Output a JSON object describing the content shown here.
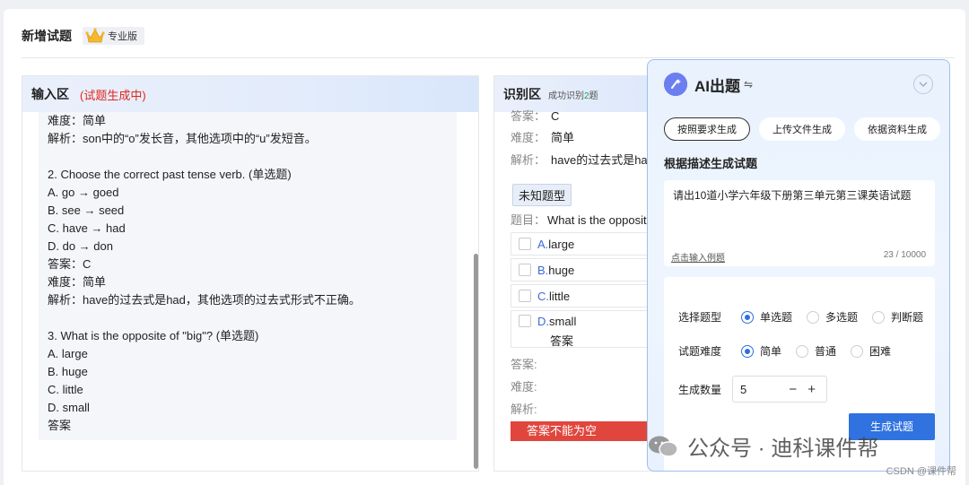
{
  "page": {
    "title": "新增试题",
    "badge": "专业版"
  },
  "input_panel": {
    "title": "输入区",
    "status": "(试题生成中)",
    "lines": [
      "难度：简单",
      "解析：son中的“o”发长音，其他选项中的“u”发短音。",
      "",
      "2. Choose the correct past tense verb. (单选题)",
      "A. go → goed",
      "B. see → seed",
      "C. have → had",
      "D. do → don",
      "答案：C",
      "难度：简单",
      "解析：have的过去式是had，其他选项的过去式形式不正确。",
      "",
      "3. What is the opposite of \"big\"? (单选题)",
      "A. large",
      "B. huge",
      "C. little",
      "D. small",
      "答案"
    ]
  },
  "recognition_panel": {
    "title": "识别区",
    "success_prefix": "成功识别",
    "success_count": "2",
    "success_suffix": "题",
    "answer_label_top": "答案：",
    "answer_value_top": "C",
    "difficulty_label": "难度：",
    "difficulty_value": "简单",
    "analysis_label": "解析：",
    "analysis_value": "have的过去式是had,",
    "type_tag": "未知题型",
    "question_label": "题目：",
    "question_value": "What is the opposit",
    "options": [
      {
        "letter": "A.",
        "text": "large"
      },
      {
        "letter": "B.",
        "text": "huge"
      },
      {
        "letter": "C.",
        "text": "little"
      },
      {
        "letter": "D.",
        "text": "small"
      }
    ],
    "option_extra": "答案",
    "answer_label": "答案:",
    "difficulty_label2": "难度:",
    "analysis_label2": "解析:",
    "error": "答案不能为空"
  },
  "ai_panel": {
    "title": "AI出题",
    "swap_icon": "⇋",
    "tabs": [
      "按照要求生成",
      "上传文件生成",
      "依据资料生成"
    ],
    "section_title": "根据描述生成试题",
    "prompt": "请出10道小学六年级下册第三单元第三课英语试题",
    "example_link": "点击输入例题",
    "char_count": "23 / 10000",
    "type_label": "选择题型",
    "type_options": [
      "单选题",
      "多选题",
      "判断题"
    ],
    "difficulty_label": "试题难度",
    "difficulty_options": [
      "简单",
      "普通",
      "困难"
    ],
    "count_label": "生成数量",
    "count_value": "5",
    "stepper_controls": "− +",
    "generate_button": "生成试题"
  },
  "watermark": {
    "text": "公众号 · 迪科课件帮",
    "csdn": "CSDN @课件帮"
  },
  "colors": {
    "accent": "#2f72e0",
    "error": "#e0463d",
    "status_red": "#e0261e"
  }
}
